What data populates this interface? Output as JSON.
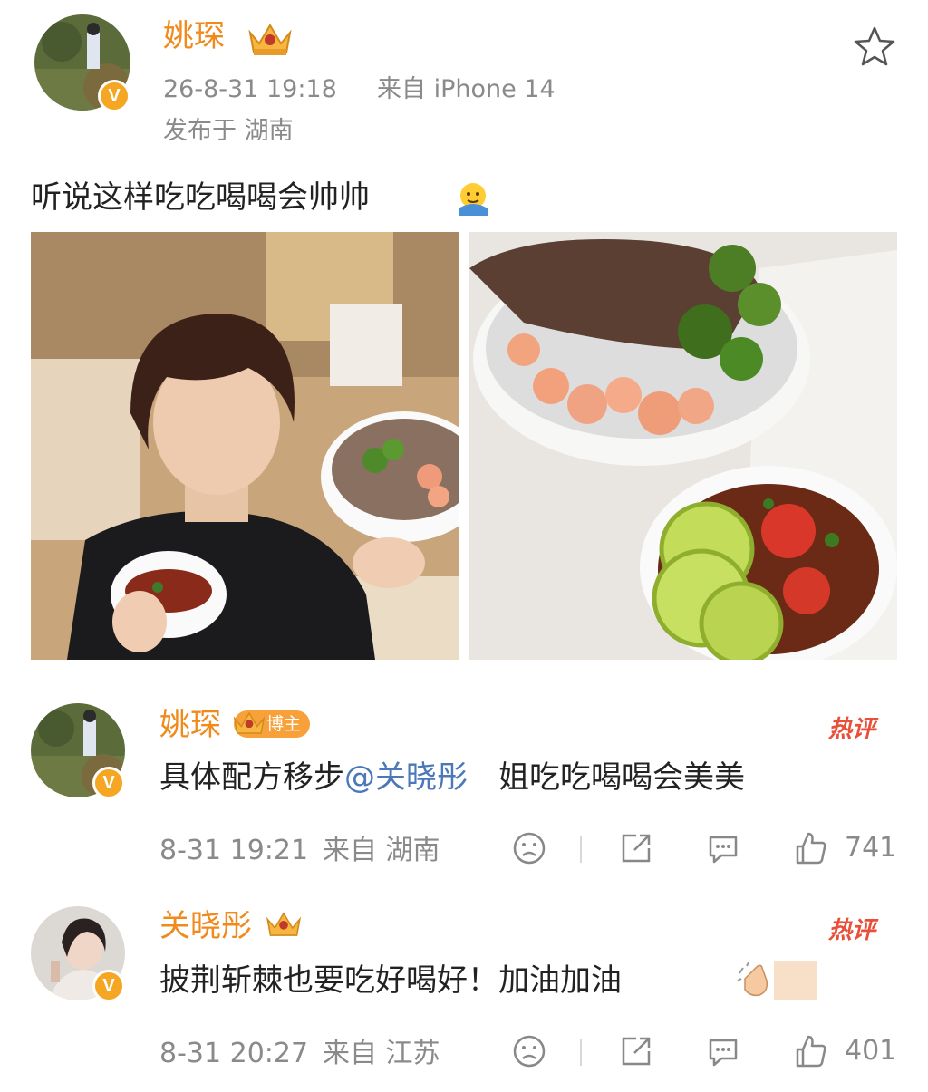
{
  "post": {
    "author": "姚琛",
    "time": "26-8-31 19:18",
    "source": "来自 iPhone 14",
    "location": "发布于 湖南",
    "text": "听说这样吃吃喝喝会帅帅"
  },
  "comments": [
    {
      "author": "姚琛",
      "badge": "博主",
      "text_prefix": "具体配方移步",
      "mention": "@关晓彤",
      "text_suffix": "姐吃吃喝喝会美美",
      "hot": "热评",
      "time": "8-31 19:21",
      "source": "来自 湖南",
      "likes": "741"
    },
    {
      "author": "关晓彤",
      "text": "披荆斩棘也要吃好喝好！加油加油",
      "hot": "热评",
      "time": "8-31 20:27",
      "source": "来自 江苏",
      "likes": "401"
    }
  ],
  "colors": {
    "name": "#f08a1c",
    "meta": "#8a8a8a",
    "mention": "#4a78b8",
    "hot": "#e8503a",
    "verified": "#f5a623"
  },
  "icons": [
    "star-icon",
    "crown-icon",
    "verified-icon",
    "dislike-icon",
    "share-icon",
    "comment-icon",
    "like-icon",
    "emoji-icon",
    "clap-emoji-icon"
  ]
}
